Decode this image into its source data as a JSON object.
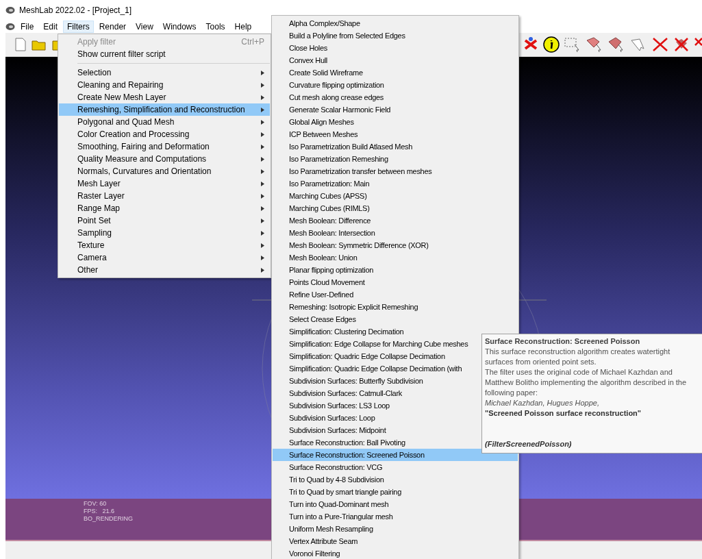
{
  "window": {
    "title": "MeshLab 2022.02 - [Project_1]"
  },
  "menubar": [
    {
      "label": "File",
      "selected": false
    },
    {
      "label": "Edit",
      "selected": false
    },
    {
      "label": "Filters",
      "selected": true
    },
    {
      "label": "Render",
      "selected": false
    },
    {
      "label": "View",
      "selected": false
    },
    {
      "label": "Windows",
      "selected": false
    },
    {
      "label": "Tools",
      "selected": false
    },
    {
      "label": "Help",
      "selected": false
    }
  ],
  "filters_menu": {
    "items": [
      {
        "kind": "action",
        "label": "Apply filter",
        "shortcut": "Ctrl+P",
        "disabled": true
      },
      {
        "kind": "action",
        "label": "Show current filter script",
        "disabled": false
      },
      {
        "kind": "separator"
      },
      {
        "kind": "submenu",
        "label": "Selection",
        "selected": false
      },
      {
        "kind": "submenu",
        "label": "Cleaning and Repairing",
        "selected": false
      },
      {
        "kind": "submenu",
        "label": "Create New Mesh Layer",
        "selected": false
      },
      {
        "kind": "submenu",
        "label": "Remeshing, Simplification and Reconstruction",
        "selected": true
      },
      {
        "kind": "submenu",
        "label": "Polygonal and Quad Mesh",
        "selected": false
      },
      {
        "kind": "submenu",
        "label": "Color Creation and Processing",
        "selected": false
      },
      {
        "kind": "submenu",
        "label": "Smoothing, Fairing and Deformation",
        "selected": false
      },
      {
        "kind": "submenu",
        "label": "Quality Measure and Computations",
        "selected": false
      },
      {
        "kind": "submenu",
        "label": "Normals, Curvatures and Orientation",
        "selected": false
      },
      {
        "kind": "submenu",
        "label": "Mesh Layer",
        "selected": false
      },
      {
        "kind": "submenu",
        "label": "Raster Layer",
        "selected": false
      },
      {
        "kind": "submenu",
        "label": "Range Map",
        "selected": false
      },
      {
        "kind": "submenu",
        "label": "Point Set",
        "selected": false
      },
      {
        "kind": "submenu",
        "label": "Sampling",
        "selected": false
      },
      {
        "kind": "submenu",
        "label": "Texture",
        "selected": false
      },
      {
        "kind": "submenu",
        "label": "Camera",
        "selected": false
      },
      {
        "kind": "submenu",
        "label": "Other",
        "selected": false
      }
    ]
  },
  "submenu": {
    "items": [
      {
        "label": "Alpha Complex/Shape",
        "selected": false
      },
      {
        "label": "Build a Polyline from Selected Edges",
        "selected": false
      },
      {
        "label": "Close Holes",
        "selected": false
      },
      {
        "label": "Convex Hull",
        "selected": false
      },
      {
        "label": "Create Solid Wireframe",
        "selected": false
      },
      {
        "label": "Curvature flipping optimization",
        "selected": false
      },
      {
        "label": "Cut mesh along crease edges",
        "selected": false
      },
      {
        "label": "Generate Scalar Harmonic Field",
        "selected": false
      },
      {
        "label": "Global Align Meshes",
        "selected": false
      },
      {
        "label": "ICP Between Meshes",
        "selected": false
      },
      {
        "label": "Iso Parametrization Build Atlased Mesh",
        "selected": false
      },
      {
        "label": "Iso Parametrization Remeshing",
        "selected": false
      },
      {
        "label": "Iso Parametrization transfer between meshes",
        "selected": false
      },
      {
        "label": "Iso Parametrization: Main",
        "selected": false
      },
      {
        "label": "Marching Cubes (APSS)",
        "selected": false
      },
      {
        "label": "Marching Cubes (RIMLS)",
        "selected": false
      },
      {
        "label": "Mesh Boolean: Difference",
        "selected": false
      },
      {
        "label": "Mesh Boolean: Intersection",
        "selected": false
      },
      {
        "label": "Mesh Boolean: Symmetric Difference (XOR)",
        "selected": false
      },
      {
        "label": "Mesh Boolean: Union",
        "selected": false
      },
      {
        "label": "Planar flipping optimization",
        "selected": false
      },
      {
        "label": "Points Cloud Movement",
        "selected": false
      },
      {
        "label": "Refine User-Defined",
        "selected": false
      },
      {
        "label": "Remeshing: Isotropic Explicit Remeshing",
        "selected": false
      },
      {
        "label": "Select Crease Edges",
        "selected": false
      },
      {
        "label": "Simplification: Clustering Decimation",
        "selected": false
      },
      {
        "label": "Simplification: Edge Collapse for Marching Cube meshes",
        "selected": false
      },
      {
        "label": "Simplification: Quadric Edge Collapse Decimation",
        "selected": false
      },
      {
        "label": "Simplification: Quadric Edge Collapse Decimation (with",
        "selected": false
      },
      {
        "label": "Subdivision Surfaces: Butterfly Subdivision",
        "selected": false
      },
      {
        "label": "Subdivision Surfaces: Catmull-Clark",
        "selected": false
      },
      {
        "label": "Subdivision Surfaces: LS3 Loop",
        "selected": false
      },
      {
        "label": "Subdivision Surfaces: Loop",
        "selected": false
      },
      {
        "label": "Subdivision Surfaces: Midpoint",
        "selected": false
      },
      {
        "label": "Surface Reconstruction: Ball Pivoting",
        "selected": false
      },
      {
        "label": "Surface Reconstruction: Screened Poisson",
        "selected": true
      },
      {
        "label": "Surface Reconstruction: VCG",
        "selected": false
      },
      {
        "label": "Tri to Quad by 4-8 Subdivision",
        "selected": false
      },
      {
        "label": "Tri to Quad by smart triangle pairing",
        "selected": false
      },
      {
        "label": "Turn into Quad-Dominant mesh",
        "selected": false
      },
      {
        "label": "Turn into a Pure-Triangular mesh",
        "selected": false
      },
      {
        "label": "Uniform Mesh Resampling",
        "selected": false
      },
      {
        "label": "Vertex Attribute Seam",
        "selected": false
      },
      {
        "label": "Voronoi Filtering",
        "selected": false
      }
    ]
  },
  "tooltip": {
    "title": "Surface Reconstruction: Screened Poisson",
    "paragraphs": [
      "This surface reconstruction algorithm creates watertight surfaces from oriented point sets.",
      "The filter uses the original code of Michael Kazhdan and Matthew Bolitho implementing the algorithm described in the following paper:"
    ],
    "authors": "Michael Kazhdan, Hugues Hoppe,",
    "paper": "\"Screened Poisson surface reconstruction\"",
    "class_name": "(FilterScreenedPoisson)"
  },
  "viewport": {
    "info": [
      "FOV: 60",
      "FPS:   21.6",
      "BO_RENDERING"
    ]
  }
}
